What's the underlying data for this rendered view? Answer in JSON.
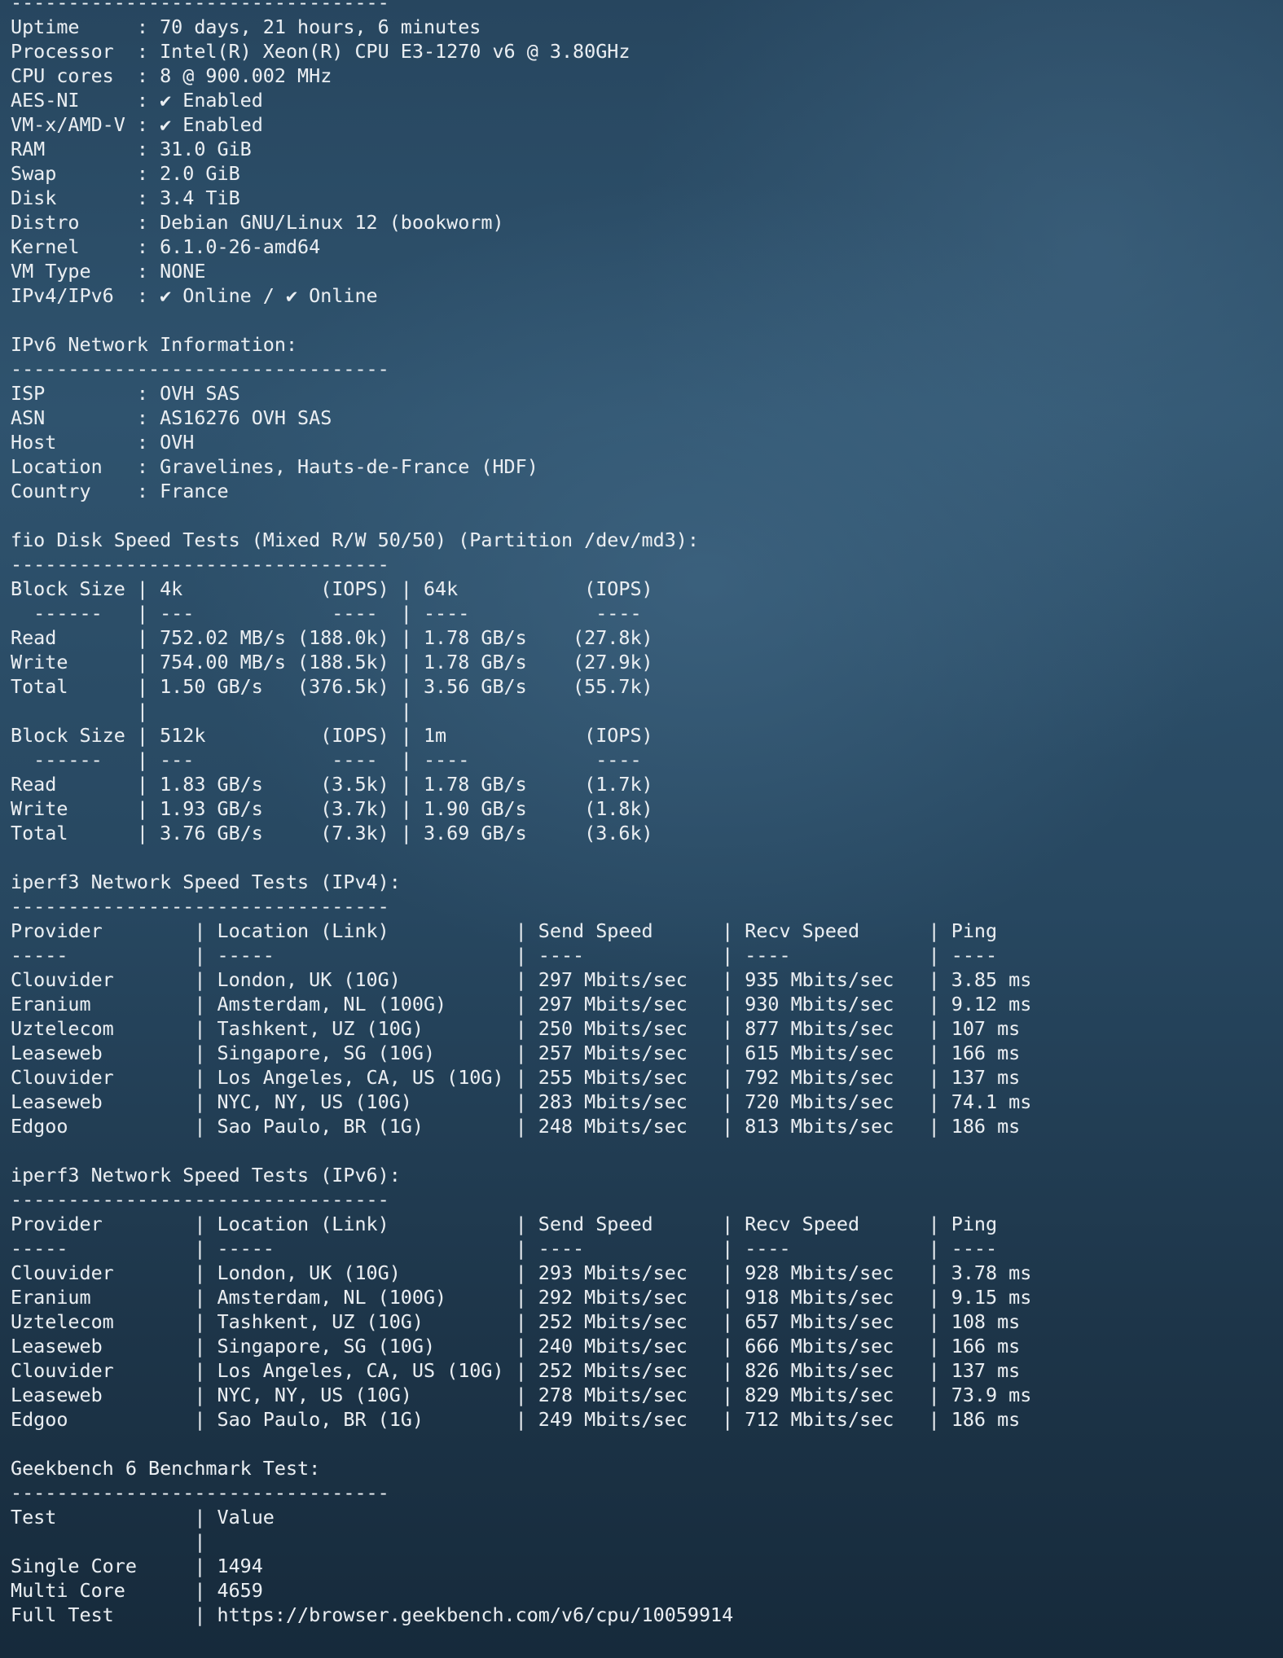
{
  "lines": [
    "---------------------------------",
    "Uptime     : 70 days, 21 hours, 6 minutes",
    "Processor  : Intel(R) Xeon(R) CPU E3-1270 v6 @ 3.80GHz",
    "CPU cores  : 8 @ 900.002 MHz",
    "AES-NI     : ✔ Enabled",
    "VM-x/AMD-V : ✔ Enabled",
    "RAM        : 31.0 GiB",
    "Swap       : 2.0 GiB",
    "Disk       : 3.4 TiB",
    "Distro     : Debian GNU/Linux 12 (bookworm)",
    "Kernel     : 6.1.0-26-amd64",
    "VM Type    : NONE",
    "IPv4/IPv6  : ✔ Online / ✔ Online",
    "",
    "IPv6 Network Information:",
    "---------------------------------",
    "ISP        : OVH SAS",
    "ASN        : AS16276 OVH SAS",
    "Host       : OVH",
    "Location   : Gravelines, Hauts-de-France (HDF)",
    "Country    : France",
    "",
    "fio Disk Speed Tests (Mixed R/W 50/50) (Partition /dev/md3):",
    "---------------------------------",
    "Block Size | 4k            (IOPS) | 64k           (IOPS)",
    "  ------   | ---            ----  | ----           ----",
    "Read       | 752.02 MB/s (188.0k) | 1.78 GB/s    (27.8k)",
    "Write      | 754.00 MB/s (188.5k) | 1.78 GB/s    (27.9k)",
    "Total      | 1.50 GB/s   (376.5k) | 3.56 GB/s    (55.7k)",
    "           |                      |",
    "Block Size | 512k          (IOPS) | 1m            (IOPS)",
    "  ------   | ---            ----  | ----           ----",
    "Read       | 1.83 GB/s     (3.5k) | 1.78 GB/s     (1.7k)",
    "Write      | 1.93 GB/s     (3.7k) | 1.90 GB/s     (1.8k)",
    "Total      | 3.76 GB/s     (7.3k) | 3.69 GB/s     (3.6k)",
    "",
    "iperf3 Network Speed Tests (IPv4):",
    "---------------------------------",
    "Provider        | Location (Link)           | Send Speed      | Recv Speed      | Ping",
    "-----           | -----                     | ----            | ----            | ----",
    "Clouvider       | London, UK (10G)          | 297 Mbits/sec   | 935 Mbits/sec   | 3.85 ms",
    "Eranium         | Amsterdam, NL (100G)      | 297 Mbits/sec   | 930 Mbits/sec   | 9.12 ms",
    "Uztelecom       | Tashkent, UZ (10G)        | 250 Mbits/sec   | 877 Mbits/sec   | 107 ms",
    "Leaseweb        | Singapore, SG (10G)       | 257 Mbits/sec   | 615 Mbits/sec   | 166 ms",
    "Clouvider       | Los Angeles, CA, US (10G) | 255 Mbits/sec   | 792 Mbits/sec   | 137 ms",
    "Leaseweb        | NYC, NY, US (10G)         | 283 Mbits/sec   | 720 Mbits/sec   | 74.1 ms",
    "Edgoo           | Sao Paulo, BR (1G)        | 248 Mbits/sec   | 813 Mbits/sec   | 186 ms",
    "",
    "iperf3 Network Speed Tests (IPv6):",
    "---------------------------------",
    "Provider        | Location (Link)           | Send Speed      | Recv Speed      | Ping",
    "-----           | -----                     | ----            | ----            | ----",
    "Clouvider       | London, UK (10G)          | 293 Mbits/sec   | 928 Mbits/sec   | 3.78 ms",
    "Eranium         | Amsterdam, NL (100G)      | 292 Mbits/sec   | 918 Mbits/sec   | 9.15 ms",
    "Uztelecom       | Tashkent, UZ (10G)        | 252 Mbits/sec   | 657 Mbits/sec   | 108 ms",
    "Leaseweb        | Singapore, SG (10G)       | 240 Mbits/sec   | 666 Mbits/sec   | 166 ms",
    "Clouvider       | Los Angeles, CA, US (10G) | 252 Mbits/sec   | 826 Mbits/sec   | 137 ms",
    "Leaseweb        | NYC, NY, US (10G)         | 278 Mbits/sec   | 829 Mbits/sec   | 73.9 ms",
    "Edgoo           | Sao Paulo, BR (1G)        | 249 Mbits/sec   | 712 Mbits/sec   | 186 ms",
    "",
    "Geekbench 6 Benchmark Test:",
    "---------------------------------",
    "Test            | Value",
    "                |",
    "Single Core     | 1494",
    "Multi Core      | 4659",
    "Full Test       | https://browser.geekbench.com/v6/cpu/10059914"
  ]
}
